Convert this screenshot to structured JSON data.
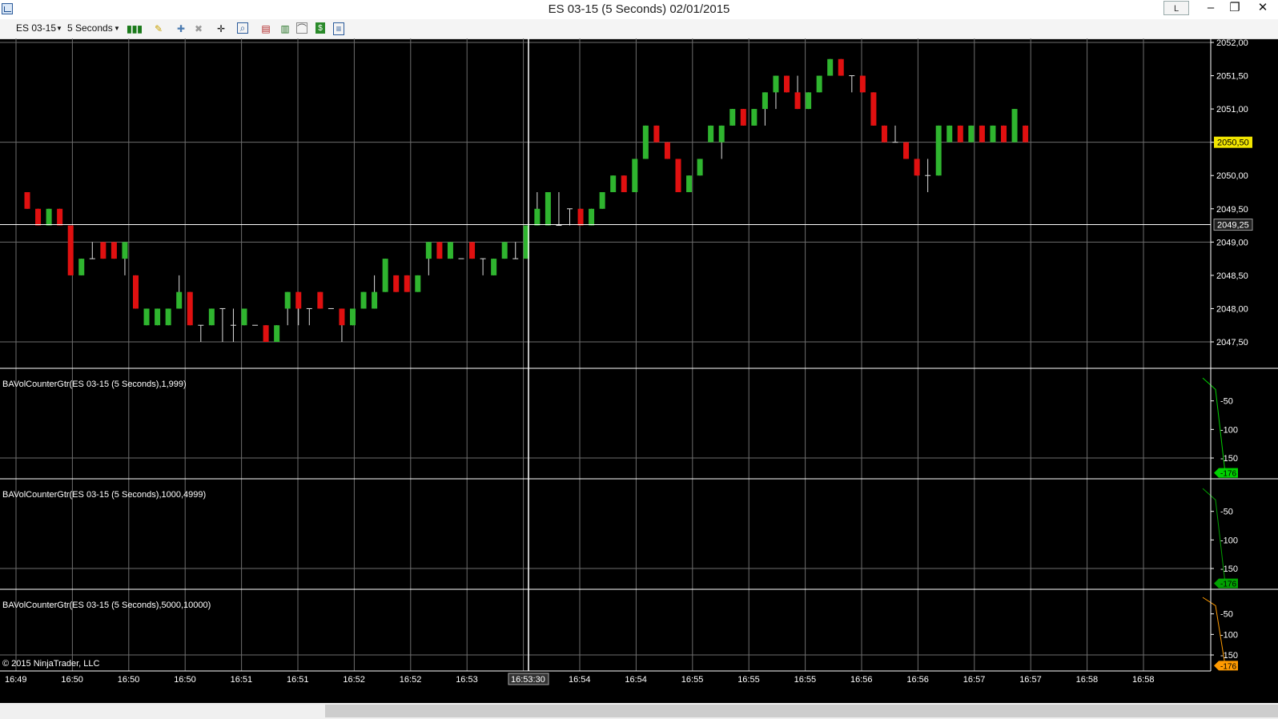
{
  "window": {
    "title": "ES 03-15 (5 Seconds)  02/01/2015",
    "link_button": "L"
  },
  "toolbar": {
    "instrument": "ES 03-15",
    "interval": "5 Seconds",
    "icons": [
      "bar-type-icon",
      "drawing-tool-icon",
      "add-indicator-icon",
      "remove-indicator-icon",
      "crosshair-icon",
      "zoom-icon",
      "strategy-icon",
      "chart-style-icon",
      "chart-properties-icon",
      "data-box-icon",
      "properties-icon"
    ]
  },
  "chart": {
    "price_axis_labels": [
      "2052,00",
      "2051,50",
      "2051,00",
      "2050,50",
      "2050,00",
      "2049,50",
      "2049,00",
      "2048,50",
      "2048,00",
      "2047,50"
    ],
    "last_price_label": "2050,50",
    "crosshair_price_label": "2049,25",
    "crosshair_time_label": "16:53:30",
    "time_axis_labels": [
      "16:49",
      "16:50",
      "16:50",
      "16:50",
      "16:51",
      "16:51",
      "16:52",
      "16:52",
      "16:53",
      "16:53",
      "16:54",
      "16:54",
      "16:55",
      "16:55",
      "16:55",
      "16:56",
      "16:56",
      "16:57",
      "16:57",
      "16:58",
      "16:58"
    ],
    "copyright": "© 2015 NinjaTrader, LLC",
    "colors": {
      "up": "#2fb52f",
      "down": "#e01010",
      "background": "#000000",
      "grid": "#6e6e6e",
      "last_price_bg": "#f2e600"
    },
    "panels": [
      {
        "label": "BAVolCounterGtr(ES 03-15 (5 Seconds),1,999)",
        "axis": [
          "-50",
          "-100",
          "-150"
        ],
        "value_label": "-176",
        "color": "#00d000"
      },
      {
        "label": "BAVolCounterGtr(ES 03-15 (5 Seconds),1000,4999)",
        "axis": [
          "-50",
          "-100",
          "-150"
        ],
        "value_label": "-176",
        "color": "#00a000"
      },
      {
        "label": "BAVolCounterGtr(ES 03-15 (5 Seconds),5000,10000)",
        "axis": [
          "-50",
          "-100",
          "-150"
        ],
        "value_label": "-176",
        "color": "#ff9a00"
      }
    ]
  },
  "chart_data": {
    "type": "candlestick",
    "ylim": [
      2047.25,
      2052.0
    ],
    "series": [
      {
        "type": "candlestick",
        "values": [
          [
            2049.75,
            2049.75,
            2049.5,
            2049.5
          ],
          [
            2049.5,
            2049.5,
            2049.25,
            2049.25
          ],
          [
            2049.25,
            2049.5,
            2049.25,
            2049.5
          ],
          [
            2049.5,
            2049.5,
            2049.25,
            2049.25
          ],
          [
            2049.25,
            2049.25,
            2048.5,
            2048.5
          ],
          [
            2048.5,
            2048.75,
            2048.5,
            2048.75
          ],
          [
            2048.75,
            2049.0,
            2048.75,
            2048.75
          ],
          [
            2049.0,
            2049.0,
            2048.75,
            2048.75
          ],
          [
            2049.0,
            2049.0,
            2048.75,
            2048.75
          ],
          [
            2048.75,
            2049.0,
            2048.5,
            2049.0
          ],
          [
            2048.5,
            2048.5,
            2048.0,
            2048.0
          ],
          [
            2047.75,
            2048.0,
            2047.75,
            2048.0
          ],
          [
            2047.75,
            2048.0,
            2047.75,
            2048.0
          ],
          [
            2047.75,
            2048.0,
            2047.75,
            2048.0
          ],
          [
            2048.0,
            2048.5,
            2048.0,
            2048.25
          ],
          [
            2048.25,
            2048.25,
            2047.75,
            2047.75
          ],
          [
            2047.75,
            2047.75,
            2047.5,
            2047.75
          ],
          [
            2047.75,
            2048.0,
            2047.75,
            2048.0
          ],
          [
            2048.0,
            2048.0,
            2047.5,
            2048.0
          ],
          [
            2047.75,
            2048.0,
            2047.5,
            2047.75
          ],
          [
            2047.75,
            2048.0,
            2047.75,
            2048.0
          ],
          [
            2047.75,
            2047.75,
            2047.75,
            2047.75
          ],
          [
            2047.75,
            2047.75,
            2047.5,
            2047.5
          ],
          [
            2047.5,
            2047.75,
            2047.5,
            2047.75
          ],
          [
            2048.0,
            2048.25,
            2047.75,
            2048.25
          ],
          [
            2048.25,
            2048.25,
            2047.75,
            2048.0
          ],
          [
            2048.0,
            2048.0,
            2047.75,
            2048.0
          ],
          [
            2048.25,
            2048.25,
            2048.0,
            2048.0
          ],
          [
            2048.0,
            2048.0,
            2048.0,
            2048.0
          ],
          [
            2048.0,
            2048.0,
            2047.5,
            2047.75
          ],
          [
            2047.75,
            2048.0,
            2047.75,
            2048.0
          ],
          [
            2048.0,
            2048.25,
            2048.0,
            2048.25
          ],
          [
            2048.0,
            2048.5,
            2048.0,
            2048.25
          ],
          [
            2048.25,
            2048.75,
            2048.25,
            2048.75
          ],
          [
            2048.5,
            2048.5,
            2048.25,
            2048.25
          ],
          [
            2048.5,
            2048.5,
            2048.25,
            2048.25
          ],
          [
            2048.25,
            2048.5,
            2048.25,
            2048.5
          ],
          [
            2048.75,
            2049.0,
            2048.5,
            2049.0
          ],
          [
            2049.0,
            2049.0,
            2048.75,
            2048.75
          ],
          [
            2048.75,
            2049.0,
            2048.75,
            2049.0
          ],
          [
            2048.75,
            2048.75,
            2048.75,
            2048.75
          ],
          [
            2049.0,
            2049.0,
            2048.75,
            2048.75
          ],
          [
            2048.75,
            2048.75,
            2048.5,
            2048.75
          ],
          [
            2048.5,
            2048.75,
            2048.5,
            2048.75
          ],
          [
            2048.75,
            2049.0,
            2048.75,
            2049.0
          ],
          [
            2048.75,
            2049.0,
            2048.75,
            2048.75
          ],
          [
            2048.75,
            2049.25,
            2048.75,
            2049.25
          ],
          [
            2049.25,
            2049.75,
            2049.25,
            2049.5
          ],
          [
            2049.25,
            2049.75,
            2049.25,
            2049.75
          ],
          [
            2049.25,
            2049.75,
            2049.25,
            2049.25
          ],
          [
            2049.5,
            2049.5,
            2049.25,
            2049.5
          ],
          [
            2049.5,
            2049.5,
            2049.25,
            2049.25
          ],
          [
            2049.25,
            2049.5,
            2049.25,
            2049.5
          ],
          [
            2049.5,
            2049.75,
            2049.5,
            2049.75
          ],
          [
            2049.75,
            2050.0,
            2049.75,
            2050.0
          ],
          [
            2050.0,
            2050.0,
            2049.75,
            2049.75
          ],
          [
            2049.75,
            2050.25,
            2049.75,
            2050.25
          ],
          [
            2050.25,
            2050.75,
            2050.25,
            2050.75
          ],
          [
            2050.75,
            2050.75,
            2050.5,
            2050.5
          ],
          [
            2050.5,
            2050.5,
            2050.25,
            2050.25
          ],
          [
            2050.25,
            2050.25,
            2049.75,
            2049.75
          ],
          [
            2049.75,
            2050.0,
            2049.75,
            2050.0
          ],
          [
            2050.0,
            2050.25,
            2050.0,
            2050.25
          ],
          [
            2050.5,
            2050.75,
            2050.5,
            2050.75
          ],
          [
            2050.5,
            2050.75,
            2050.25,
            2050.75
          ],
          [
            2050.75,
            2051.0,
            2050.75,
            2051.0
          ],
          [
            2051.0,
            2051.0,
            2050.75,
            2050.75
          ],
          [
            2050.75,
            2051.0,
            2050.75,
            2051.0
          ],
          [
            2051.0,
            2051.25,
            2050.75,
            2051.25
          ],
          [
            2051.25,
            2051.5,
            2051.0,
            2051.5
          ],
          [
            2051.5,
            2051.5,
            2051.25,
            2051.25
          ],
          [
            2051.25,
            2051.5,
            2051.0,
            2051.0
          ],
          [
            2051.0,
            2051.25,
            2051.0,
            2051.25
          ],
          [
            2051.25,
            2051.5,
            2051.25,
            2051.5
          ],
          [
            2051.5,
            2051.75,
            2051.5,
            2051.75
          ],
          [
            2051.75,
            2051.75,
            2051.5,
            2051.5
          ],
          [
            2051.5,
            2051.5,
            2051.25,
            2051.5
          ],
          [
            2051.5,
            2051.5,
            2051.25,
            2051.25
          ],
          [
            2051.25,
            2051.25,
            2050.75,
            2050.75
          ],
          [
            2050.75,
            2050.75,
            2050.5,
            2050.5
          ],
          [
            2050.5,
            2050.75,
            2050.5,
            2050.5
          ],
          [
            2050.5,
            2050.5,
            2050.25,
            2050.25
          ],
          [
            2050.25,
            2050.25,
            2050.0,
            2050.0
          ],
          [
            2050.0,
            2050.25,
            2049.75,
            2050.0
          ],
          [
            2050.0,
            2050.75,
            2050.0,
            2050.75
          ],
          [
            2050.5,
            2050.75,
            2050.5,
            2050.75
          ],
          [
            2050.75,
            2050.75,
            2050.5,
            2050.5
          ],
          [
            2050.5,
            2050.75,
            2050.5,
            2050.75
          ],
          [
            2050.75,
            2050.75,
            2050.5,
            2050.5
          ],
          [
            2050.5,
            2050.75,
            2050.5,
            2050.75
          ],
          [
            2050.75,
            2050.75,
            2050.5,
            2050.5
          ],
          [
            2050.5,
            2051.0,
            2050.5,
            2051.0
          ],
          [
            2050.75,
            2050.75,
            2050.5,
            2050.5
          ]
        ]
      }
    ],
    "indicator_series": [
      {
        "values": [
          -10,
          -30,
          -176
        ]
      },
      {
        "values": [
          -10,
          -30,
          -176
        ]
      },
      {
        "values": [
          -10,
          -30,
          -176
        ]
      }
    ]
  }
}
